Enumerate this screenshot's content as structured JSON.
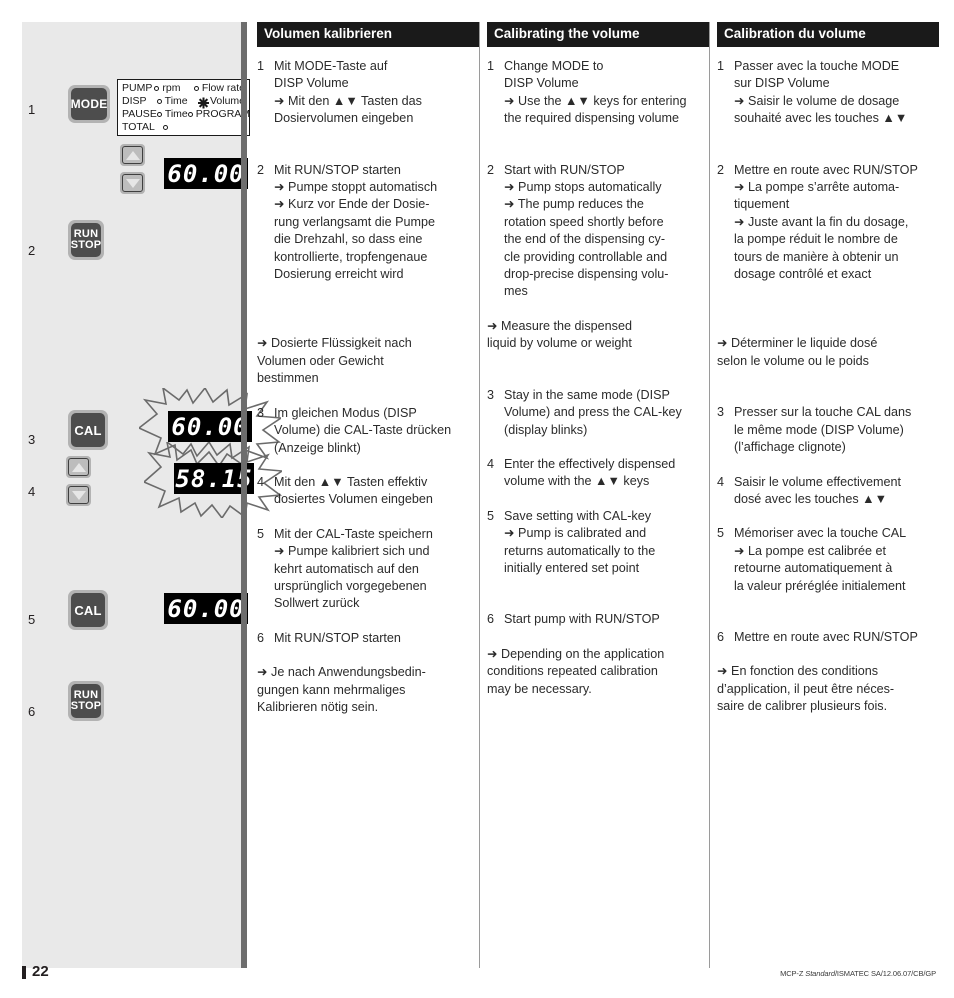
{
  "page": {
    "number": "22",
    "footer_code_prefix": "MCP-Z ",
    "footer_code_italic": "Standard",
    "footer_code_suffix": "/ISMATEC SA/12.06.07/CB/GP"
  },
  "illustration": {
    "steps": [
      "1",
      "2",
      "3",
      "4",
      "5",
      "6"
    ],
    "buttons": {
      "mode": "MODE",
      "run": "RUN",
      "stop": "STOP",
      "cal": "CAL",
      "up_arrow": "▲",
      "down_arrow": "▼"
    },
    "mode_panel": {
      "rows": [
        {
          "label": "PUMP",
          "opt1": "rpm",
          "opt1_marker": "circle",
          "opt2": "Flow rate",
          "opt2_marker": "circle"
        },
        {
          "label": "DISP",
          "opt1": "Time",
          "opt1_marker": "circle",
          "opt2": "Volume",
          "opt2_marker": "star"
        },
        {
          "label": "PAUSE",
          "opt1": "Time",
          "opt1_marker": "circle",
          "opt2": "PROGRAM",
          "opt2_marker": "circle"
        },
        {
          "label": "TOTAL",
          "opt1": "",
          "opt1_marker": "circle",
          "opt2": "",
          "opt2_marker": "none"
        }
      ]
    },
    "displays": {
      "step1": "60.00",
      "step3": "60.00",
      "step4": "58.15",
      "step5": "60.00"
    }
  },
  "columns": [
    {
      "lang": "de",
      "title": "Volumen kalibrieren",
      "blocks": [
        {
          "type": "step",
          "n": "1",
          "lines": [
            "Mit MODE-Taste auf",
            "DISP Volume",
            "➜ Mit den ▲▼ Tasten das",
            "Dosiervolumen eingeben"
          ]
        },
        {
          "type": "gap",
          "size": "md"
        },
        {
          "type": "step",
          "n": "2",
          "lines": [
            "Mit RUN/STOP starten",
            "➜ Pumpe stoppt automatisch",
            "➜ Kurz vor Ende der Dosie-",
            "rung verlangsamt die Pumpe",
            "die Drehzahl, so dass eine",
            "kontrollierte, tropfengenaue",
            "Dosierung erreicht wird"
          ]
        },
        {
          "type": "gap",
          "size": "lg"
        },
        {
          "type": "note",
          "lines": [
            "➜ Dosierte Flüssigkeit nach",
            "Volumen oder Gewicht",
            "bestimmen"
          ]
        },
        {
          "type": "gap",
          "size": "sm"
        },
        {
          "type": "step",
          "n": "3",
          "lines": [
            "Im gleichen Modus (DISP",
            "Volume) die CAL-Taste drücken",
            "(Anzeige blinkt)"
          ]
        },
        {
          "type": "gap",
          "size": "sm"
        },
        {
          "type": "step",
          "n": "4",
          "lines": [
            "Mit den ▲▼ Tasten effektiv",
            "dosiertes Volumen eingeben"
          ]
        },
        {
          "type": "gap",
          "size": "sm"
        },
        {
          "type": "step",
          "n": "5",
          "lines": [
            "Mit der CAL-Taste speichern",
            "➜ Pumpe kalibriert sich und",
            "kehrt automatisch auf den",
            "ursprünglich vorgegebenen",
            "Sollwert zurück"
          ]
        },
        {
          "type": "gap",
          "size": "sm"
        },
        {
          "type": "step",
          "n": "6",
          "lines": [
            "Mit RUN/STOP starten"
          ]
        },
        {
          "type": "gap",
          "size": "sm"
        },
        {
          "type": "note",
          "lines": [
            "➜ Je nach Anwendungsbedin-",
            "gungen kann mehrmaliges",
            "Kalibrieren nötig sein."
          ]
        }
      ]
    },
    {
      "lang": "en",
      "title": "Calibrating the volume",
      "blocks": [
        {
          "type": "step",
          "n": "1",
          "lines": [
            "Change MODE to",
            "DISP Volume",
            "➜ Use the ▲▼ keys for entering",
            "the required dispensing volume"
          ]
        },
        {
          "type": "gap",
          "size": "md"
        },
        {
          "type": "step",
          "n": "2",
          "lines": [
            "Start with RUN/STOP",
            "➜ Pump stops automatically",
            "➜ The pump reduces the",
            "rotation speed shortly before",
            "the end of the dispensing cy-",
            "cle providing controllable and",
            "drop-precise dispensing volu-",
            "mes"
          ]
        },
        {
          "type": "gap",
          "size": "sm"
        },
        {
          "type": "note",
          "lines": [
            "➜ Measure the dispensed",
            "liquid by volume or weight"
          ]
        },
        {
          "type": "gap",
          "size": "md"
        },
        {
          "type": "step",
          "n": "3",
          "lines": [
            "Stay in the same mode (DISP",
            "Volume) and press the CAL-key",
            "(display blinks)"
          ]
        },
        {
          "type": "gap",
          "size": "sm"
        },
        {
          "type": "step",
          "n": "4",
          "lines": [
            "Enter the effectively dispensed",
            "volume with the ▲▼ keys"
          ]
        },
        {
          "type": "gap",
          "size": "sm"
        },
        {
          "type": "step",
          "n": "5",
          "lines": [
            "Save setting with CAL-key",
            "➜ Pump is calibrated and",
            "returns automatically to the",
            "initially entered set point"
          ]
        },
        {
          "type": "gap",
          "size": "md"
        },
        {
          "type": "step",
          "n": "6",
          "lines": [
            "Start pump with RUN/STOP"
          ]
        },
        {
          "type": "gap",
          "size": "sm"
        },
        {
          "type": "note",
          "lines": [
            "➜ Depending on the application",
            "conditions repeated calibration",
            "may be necessary."
          ]
        }
      ]
    },
    {
      "lang": "fr",
      "title": "Calibration du volume",
      "blocks": [
        {
          "type": "step",
          "n": "1",
          "lines": [
            "Passer avec la touche MODE",
            "sur DISP Volume",
            "➜ Saisir le volume de dosage",
            "souhaité avec les touches ▲▼"
          ]
        },
        {
          "type": "gap",
          "size": "md"
        },
        {
          "type": "step",
          "n": "2",
          "lines": [
            "Mettre en route avec RUN/STOP",
            "➜ La pompe s’arrête automa-",
            "tiquement",
            "➜ Juste avant la fin du dosage,",
            "la pompe réduit le nombre de",
            "tours de manière à obtenir un",
            "dosage contrôlé et exact"
          ]
        },
        {
          "type": "gap",
          "size": "lg"
        },
        {
          "type": "note",
          "lines": [
            "➜ Déterminer le liquide dosé",
            "selon le volume ou le poids"
          ]
        },
        {
          "type": "gap",
          "size": "md"
        },
        {
          "type": "step",
          "n": "3",
          "lines": [
            "Presser sur la touche CAL dans",
            "le même mode (DISP Volume)",
            "(l’affichage clignote)"
          ]
        },
        {
          "type": "gap",
          "size": "sm"
        },
        {
          "type": "step",
          "n": "4",
          "lines": [
            "Saisir le volume effectivement",
            "dosé avec les touches ▲▼"
          ]
        },
        {
          "type": "gap",
          "size": "sm"
        },
        {
          "type": "step",
          "n": "5",
          "lines": [
            "Mémoriser avec la touche CAL",
            "➜ La pompe est calibrée et",
            "retourne automatiquement à",
            "la valeur préréglée initialement"
          ]
        },
        {
          "type": "gap",
          "size": "md"
        },
        {
          "type": "step",
          "n": "6",
          "lines": [
            "Mettre en route avec RUN/STOP"
          ]
        },
        {
          "type": "gap",
          "size": "sm"
        },
        {
          "type": "note",
          "lines": [
            "➜  En fonction des conditions",
            "d’application, il peut être néces-",
            "saire de calibrer plusieurs fois."
          ]
        }
      ]
    }
  ]
}
